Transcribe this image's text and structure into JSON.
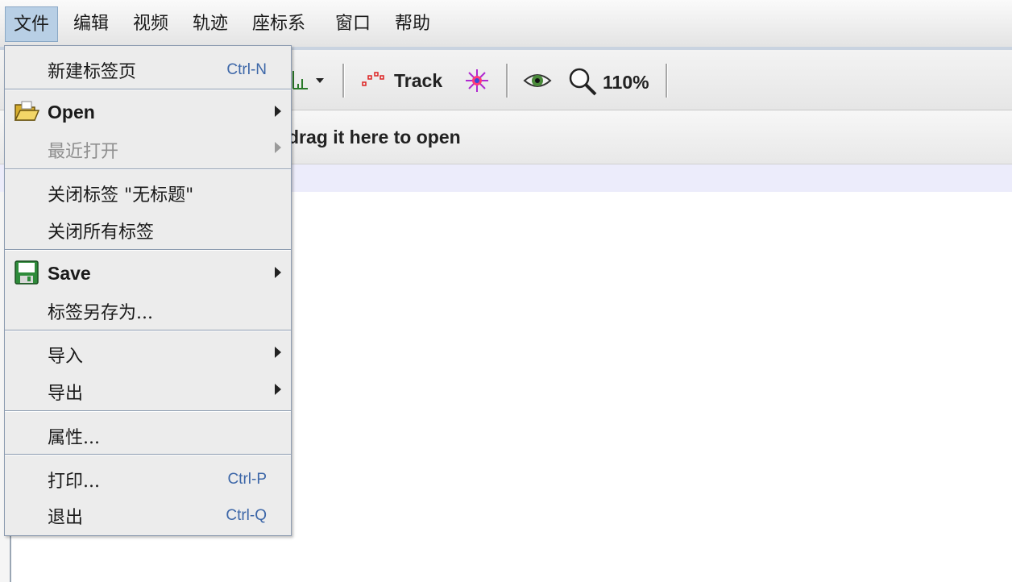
{
  "menubar": {
    "items": [
      "文件",
      "编辑",
      "视频",
      "轨迹",
      "座标系",
      "窗口",
      "帮助"
    ]
  },
  "toolbar": {
    "track_label": "Track",
    "zoom_level": "110%"
  },
  "message": {
    "text": "drag it here to open"
  },
  "file_menu": {
    "new_tab": {
      "label": "新建标签页",
      "shortcut": "Ctrl-N"
    },
    "open": {
      "label": "Open"
    },
    "recent": {
      "label": "最近打开"
    },
    "close_tab": {
      "label": "关闭标签 \"无标题\""
    },
    "close_all": {
      "label": "关闭所有标签"
    },
    "save": {
      "label": "Save"
    },
    "save_tab_as": {
      "label": "标签另存为..."
    },
    "import": {
      "label": "导入"
    },
    "export": {
      "label": "导出"
    },
    "properties": {
      "label": "属性..."
    },
    "print": {
      "label": "打印...",
      "shortcut": "Ctrl-P"
    },
    "exit": {
      "label": "退出",
      "shortcut": "Ctrl-Q"
    }
  },
  "colors": {
    "accent_shortcut": "#3d67a8",
    "active_menu_bg": "#b8cfe5",
    "save_icon": "#2e8b3a",
    "open_icon": "#e8c44a"
  }
}
